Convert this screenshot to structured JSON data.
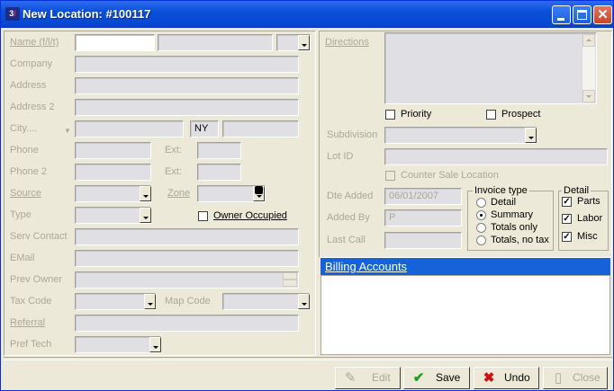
{
  "window": {
    "title": "New Location: #100117"
  },
  "left": {
    "name_label": "Name (f/l/t)",
    "company_label": "Company",
    "address_label": "Address",
    "address2_label": "Address 2",
    "city_label": "City....",
    "state_value": "NY",
    "phone_label": "Phone",
    "ext_label": "Ext:",
    "phone2_label": "Phone 2",
    "ext2_label": "Ext:",
    "source_label": "Source",
    "zone_label": "Zone",
    "type_label": "Type",
    "owner_occupied_label": "Owner Occupied",
    "serv_contact_label": "Serv Contact",
    "email_label": "EMail",
    "prev_owner_label": "Prev Owner",
    "tax_code_label": "Tax Code",
    "map_code_label": "Map Code",
    "referral_label": "Referral",
    "pref_tech_label": "Pref Tech"
  },
  "right": {
    "directions_label": "Directions",
    "priority_label": "Priority",
    "prospect_label": "Prospect",
    "subdivision_label": "Subdivision",
    "lot_id_label": "Lot ID",
    "counter_sale_label": "Counter Sale Location",
    "date_added_label": "Dte Added",
    "date_added_value": "06/01/2007",
    "added_by_label": "Added By",
    "added_by_value": "P",
    "last_call_label": "Last Call",
    "invoice_type": {
      "title": "Invoice type",
      "options": [
        "Detail",
        "Summary",
        "Totals only",
        "Totals, no tax"
      ],
      "selected": "Summary"
    },
    "detail": {
      "title": "Detail",
      "items": [
        "Parts",
        "Labor",
        "Misc"
      ]
    },
    "billing_accounts_label": "Billing Accounts"
  },
  "toolbar": {
    "edit_label": "Edit",
    "save_label": "Save",
    "undo_label": "Undo",
    "close_label": "Close"
  },
  "colors": {
    "title_bar": "#0A4FD8",
    "billing_header": "#1662D9",
    "disabled_text": "#ACA899",
    "save_icon": "#1E9E1E",
    "undo_icon": "#D01010"
  }
}
